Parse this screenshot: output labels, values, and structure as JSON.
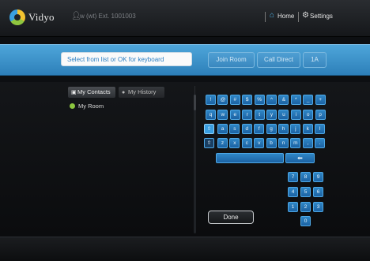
{
  "app": {
    "logo_text": "Vidyo"
  },
  "header": {
    "user_ext": "w (wt) Ext. 1001003",
    "home_label": "Home",
    "settings_label": "Settings"
  },
  "toolbar": {
    "search_placeholder": "Select from list or OK for keyboard",
    "join_label": "Join Room",
    "call_label": "Call Direct",
    "dialpad_label": "1A"
  },
  "tabs": [
    {
      "label": "My Contacts",
      "active": true
    },
    {
      "label": "My History",
      "active": false
    }
  ],
  "list": [
    {
      "label": "My Room"
    }
  ],
  "keyboard": {
    "row1": [
      "!",
      "@",
      "#",
      "$",
      "%",
      "^",
      "&",
      "*",
      "_",
      "+"
    ],
    "row2": [
      "q",
      "w",
      "e",
      "r",
      "t",
      "y",
      "u",
      "i",
      "o",
      "p"
    ],
    "row3": [
      "a",
      "s",
      "d",
      "f",
      "g",
      "h",
      "j",
      "k",
      "l"
    ],
    "row4": [
      "z",
      "x",
      "c",
      "v",
      "b",
      "n",
      "m",
      ",",
      "."
    ],
    "numpad": [
      "7",
      "8",
      "9",
      "4",
      "5",
      "6",
      "1",
      "2",
      "3",
      "0"
    ],
    "shift_glyph": "⇧",
    "backspace_glyph": "⬅"
  },
  "done_label": "Done",
  "colors": {
    "accent": "#3b8fcd",
    "key": "#2b7fc3",
    "room_status": "#8cc63f"
  }
}
